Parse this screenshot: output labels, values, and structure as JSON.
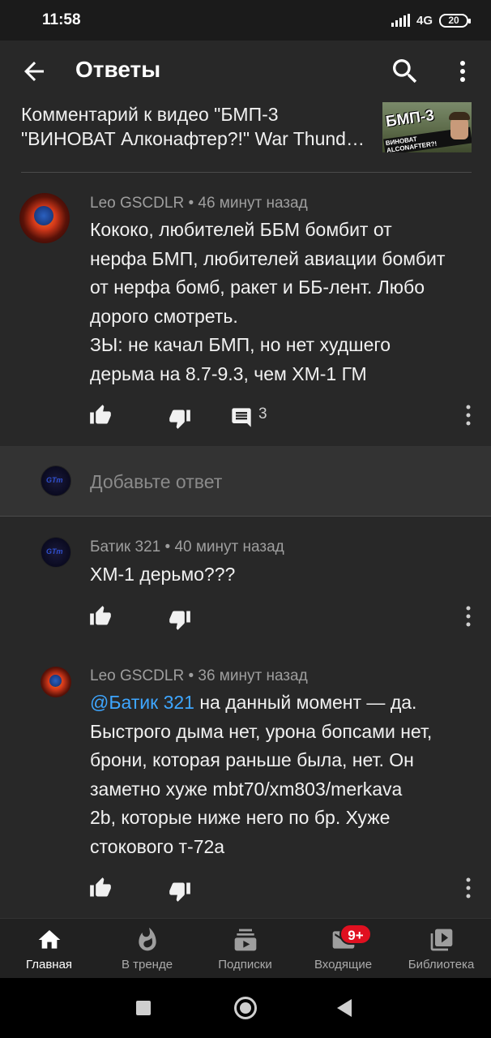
{
  "status_bar": {
    "time": "11:58",
    "network": "4G",
    "battery": "20"
  },
  "header": {
    "title": "Ответы"
  },
  "video_ref": {
    "line1": "Комментарий к видео \"БМП-3",
    "line2": "\"ВИНОВАТ Алконафтер?!\" War Thund…",
    "thumb_title": "БМП-3",
    "thumb_sub": "ВИНОВАТ ALCONAFTER?!"
  },
  "main_comment": {
    "author": "Leo GSCDLR",
    "time": "46 минут назад",
    "lines": [
      "Кококо, любителей ББМ бомбит от",
      "нерфа БМП, любителей авиации бомбит",
      "от нерфа бомб, ракет и ББ-лент. Любо",
      "дорого смотреть.",
      "ЗЫ: не качал БМП, но нет худшего",
      "дерьма на 8.7-9.3, чем XM-1 ГМ"
    ],
    "reply_count": "3"
  },
  "add_reply": {
    "placeholder": "Добавьте ответ"
  },
  "replies": [
    {
      "author": "Батик 321",
      "time": "40 минут назад",
      "lines": [
        "XM-1 дерьмо???"
      ]
    },
    {
      "author": "Leo GSCDLR",
      "time": "36 минут назад",
      "mention": "@Батик 321",
      "first_line_rest": " на данный момент — да.",
      "lines": [
        "Быстрого дыма нет, урона бопсами нет,",
        "брони, которая раньше была, нет. Он",
        "заметно хуже mbt70/xm803/merkava",
        "2b, которые ниже него по бр. Хуже",
        "стокового т-72а"
      ]
    }
  ],
  "bottom_nav": {
    "items": [
      {
        "label": "Главная",
        "icon": "home-icon",
        "active": true
      },
      {
        "label": "В тренде",
        "icon": "fire-icon"
      },
      {
        "label": "Подписки",
        "icon": "subscriptions-icon"
      },
      {
        "label": "Входящие",
        "icon": "mail-icon",
        "badge": "9+"
      },
      {
        "label": "Библиотека",
        "icon": "library-icon"
      }
    ]
  },
  "colors": {
    "background": "#282828",
    "mention": "#3ea6ff",
    "badge": "#e01020",
    "meta_text": "#9e9e9e"
  }
}
